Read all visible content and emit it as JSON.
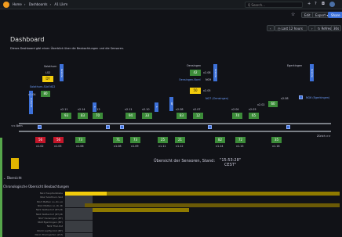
{
  "breadcrumb": [
    "Home",
    "Dashboards",
    "A1 Lärm"
  ],
  "search_placeholder": "Q Search...",
  "header_actions": [
    "Edit",
    "Export ▾",
    "Share"
  ],
  "time_range": "Last 12 hours",
  "refresh": "Refresh",
  "refresh_interval": "30s",
  "page_title": "Dashboard",
  "page_description": "Dieses Dashboard gibt einen Überblick über die Beobachtungen und die Sensoren.",
  "stations": {
    "solothurn": "Solothurn",
    "oensingen": "Oensingen",
    "egerkingen": "Egerkingen"
  },
  "sensors": [
    {
      "id": "s1",
      "code": "L02",
      "val": "DY"
    },
    {
      "id": "s2",
      "code": "Solothurn-Süd NG2"
    },
    {
      "id": "s3",
      "code": "v1.04",
      "val": "80"
    },
    {
      "id": "s4",
      "code": "v2.08",
      "val": "42"
    },
    {
      "id": "s5",
      "code": "Oensingen-Nord",
      "extra": "NG9"
    },
    {
      "id": "s6",
      "code": "v2.05",
      "val": "50"
    },
    {
      "id": "s7",
      "code": "NG7 (Oensingen)"
    },
    {
      "id": "s8",
      "code": "v2.02",
      "val": "60"
    },
    {
      "id": "s9",
      "code": "NG6 (Egerkingen)"
    },
    {
      "id": "s10",
      "code": "v2.08"
    }
  ],
  "row_top": [
    {
      "code": "v2.11",
      "val": "93"
    },
    {
      "code": "v2.14",
      "val": "83"
    },
    {
      "code": "v2.13",
      "val": "70"
    },
    {
      "code": "v2.11",
      "val": "94"
    },
    {
      "code": "v2.10",
      "val": "33"
    },
    {
      "code": "v2.08",
      "val": "83"
    },
    {
      "code": "v2.07",
      "val": "12"
    },
    {
      "code": "v2.04",
      "val": "74"
    },
    {
      "code": "v2.03",
      "val": "65"
    }
  ],
  "row_bottom": [
    {
      "code": "v1.02",
      "val": "56"
    },
    {
      "code": "v1.05",
      "val": "56"
    },
    {
      "code": "v1.06",
      "val": "73"
    },
    {
      "code": "v1.08",
      "val": "71"
    },
    {
      "code": "v1.09",
      "val": "73"
    },
    {
      "code": "v1.11",
      "val": "25"
    },
    {
      "code": "v1.12",
      "val": "21"
    },
    {
      "code": "v1.14",
      "val": "82"
    },
    {
      "code": "v1.15",
      "val": "72"
    },
    {
      "code": "v1.16",
      "val": "35"
    }
  ],
  "bern_label": "<< Bern",
  "zurich_label": "Zürich >>",
  "stamp_label": "Übersicht der Sensoren, Stand:",
  "stamp_time": "15:53:28",
  "stamp_zone": "CEST",
  "overview_label": "Übersicht",
  "overview_sub": "Chronologische Übersicht Beobachtungen",
  "timeline": [
    {
      "name": "NG1 Hauptleitstelle",
      "segs": [
        {
          "color": "#f2cc0c",
          "w": 0.15
        },
        {
          "color": "#8f7a00",
          "w": 0.85
        }
      ]
    },
    {
      "name": "NG2 Solothurn-Süd",
      "segs": [
        {
          "color": "#3a3d42",
          "w": 0.1
        }
      ]
    },
    {
      "name": "NG3 Matten Lo.-Ri.-Lü",
      "segs": [
        {
          "color": "#3a3d42",
          "w": 0.1
        }
      ]
    },
    {
      "name": "NG4 Matten Lo.-Ri.-Bi",
      "segs": [
        {
          "color": "#3a3d42",
          "w": 0.07
        },
        {
          "color": "#6b5a06",
          "w": 0.93
        }
      ]
    },
    {
      "name": "NG5 Wattenhof (NT)-Bi",
      "segs": [
        {
          "color": "#3a3d42",
          "w": 0.1
        },
        {
          "color": "#8f7a00",
          "w": 0.35
        }
      ]
    },
    {
      "name": "NG6 Wattenhof (NT)-Bi",
      "segs": [
        {
          "color": "#3a3d42",
          "w": 0.1
        }
      ]
    },
    {
      "name": "NG7 Oensingen (NT)",
      "segs": [
        {
          "color": "#3a3d42",
          "w": 0.1
        }
      ]
    },
    {
      "name": "NG8 Egerkingen (NT)",
      "segs": [
        {
          "color": "#3a3d42",
          "w": 0.1
        }
      ]
    },
    {
      "name": "NG9 Thal-Ost",
      "segs": [
        {
          "color": "#3a3d42",
          "w": 0.1
        }
      ]
    },
    {
      "name": "NG10 Lupfig-Süd (NT)",
      "segs": [
        {
          "color": "#3a3d42",
          "w": 0.1
        }
      ]
    },
    {
      "name": "NG11 Bremgarten (Zof)",
      "segs": [
        {
          "color": "#3a3d42",
          "w": 0.1
        }
      ]
    }
  ]
}
